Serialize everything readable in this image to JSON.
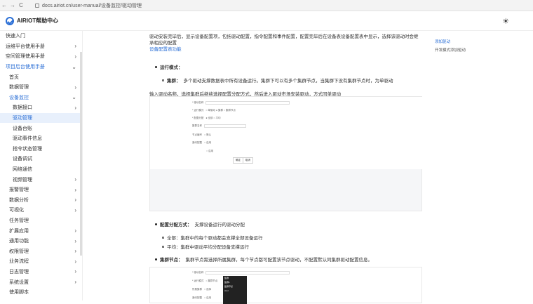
{
  "browser": {
    "back": "←",
    "forward": "→",
    "reload": "C",
    "url": "docs.airiot.cn/user-manual/设备监控/驱动管理"
  },
  "header": {
    "title": "AIRIOT帮助中心",
    "theme_icon": "sun-icon"
  },
  "sidebar": {
    "items": [
      {
        "label": "快速入门",
        "level": 1,
        "chevron": false
      },
      {
        "label": "运维平台使用手册",
        "level": 1,
        "chevron": true
      },
      {
        "label": "空间管理使用手册",
        "level": 1,
        "chevron": true
      },
      {
        "label": "项目后台使用手册",
        "level": 1,
        "chevron": true,
        "expanded": true,
        "highlight": true
      },
      {
        "label": "首页",
        "level": 2,
        "chevron": false
      },
      {
        "label": "数据管理",
        "level": 2,
        "chevron": true
      },
      {
        "label": "设备监控",
        "level": 2,
        "chevron": true,
        "expanded": true,
        "highlight": true
      },
      {
        "label": "数据接口",
        "level": 3,
        "chevron": true
      },
      {
        "label": "驱动管理",
        "level": 3,
        "chevron": false,
        "active": true
      },
      {
        "label": "设备台账",
        "level": 3,
        "chevron": false
      },
      {
        "label": "驱动事件信息",
        "level": 3,
        "chevron": false
      },
      {
        "label": "指令状态管理",
        "level": 3,
        "chevron": false
      },
      {
        "label": "设备调试",
        "level": 3,
        "chevron": false
      },
      {
        "label": "网络通信",
        "level": 3,
        "chevron": false
      },
      {
        "label": "视频管理",
        "level": 3,
        "chevron": true
      },
      {
        "label": "报警管理",
        "level": 2,
        "chevron": true
      },
      {
        "label": "数据分析",
        "level": 2,
        "chevron": true
      },
      {
        "label": "可视化",
        "level": 2,
        "chevron": true
      },
      {
        "label": "任务管理",
        "level": 2,
        "chevron": false
      },
      {
        "label": "扩展应用",
        "level": 2,
        "chevron": true
      },
      {
        "label": "通用功能",
        "level": 2,
        "chevron": true
      },
      {
        "label": "权限管理",
        "level": 2,
        "chevron": true
      },
      {
        "label": "业务流程",
        "level": 2,
        "chevron": true
      },
      {
        "label": "日志管理",
        "level": 2,
        "chevron": true
      },
      {
        "label": "系统设置",
        "level": 2,
        "chevron": true
      },
      {
        "label": "使用脚本",
        "level": 2,
        "chevron": false
      }
    ]
  },
  "content": {
    "intro_line1": "驱动安装完毕后，显示设备配置项，包括驱动配置，指令配置和事件配置，配置完毕后在设备表设备配置表中显示，选择该驱动时会继",
    "intro_line2": "承相应的配置",
    "config_link": "设备配置表功能",
    "run_mode_label": "运行模式：",
    "cluster_label": "集群：",
    "cluster_text": "多个驱动支撑数据表中所有设备运行。集群下可以有多个集群节点，当集群下没有集群节点时，为单驱动",
    "input_instruction": "输入驱动名称，选择集群后继续选择配置分配方式，然后进入驱动市场安装驱动，方式同单驱动",
    "assign_label": "配置分配方式：",
    "assign_text": "支撑设备运行的驱动分配",
    "assign_all": "全部：集群中的每个驱动都会支撑全部设备运行",
    "assign_avg": "平均：集群中驱动平均分配设备支撑运行",
    "node_label": "集群节点：",
    "node_text": "集群节点需选择所属集群，每个节点都可配置该节点驱动，不配置默认同集群驱动配置信息。"
  },
  "toc": {
    "items": [
      "添加驱动",
      "开发模式添加驱动"
    ]
  }
}
